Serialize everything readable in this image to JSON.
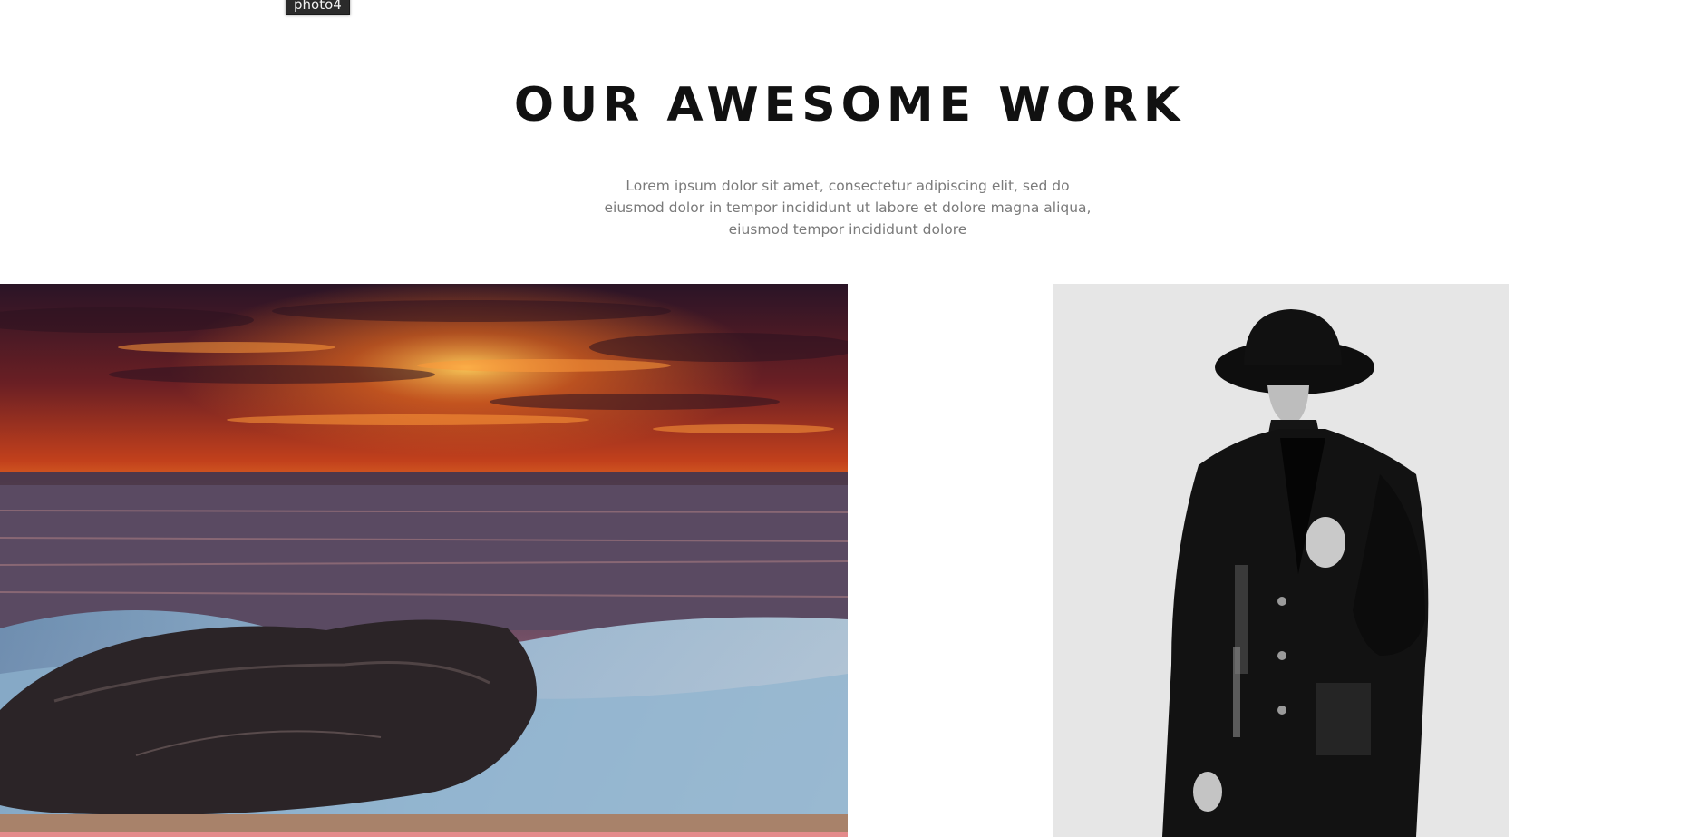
{
  "tooltip": {
    "text": "photo4"
  },
  "section": {
    "title": "OUR AWESOME WORK",
    "description": "Lorem ipsum dolor sit amet, consectetur adipiscing elit, sed do eiusmod dolor in tempor incididunt ut labore et dolore magna aliqua, eiusmod tempor incididunt dolore"
  },
  "gallery": {
    "items": [
      {
        "icon": "sunset-seascape-image"
      },
      {
        "icon": "man-in-hat-portrait-image"
      }
    ]
  },
  "colors": {
    "accent_divider": "#b29a7a",
    "heading": "#111111",
    "body_text": "#7a7a7a",
    "sky_top": "#2a1a2e",
    "sky_fire": "#e2471b",
    "sea": "#4a5a78",
    "foam": "#8fb3cf",
    "portrait_bg": "#e6e6e6"
  }
}
